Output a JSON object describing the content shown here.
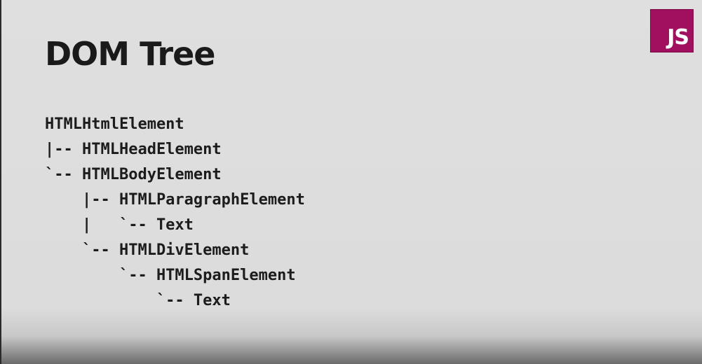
{
  "slide": {
    "title": "DOM Tree",
    "badge": "JS",
    "accent_color": "#a0105f",
    "tree_lines": [
      "HTMLHtmlElement",
      "|-- HTMLHeadElement",
      "`-- HTMLBodyElement",
      "    |-- HTMLParagraphElement",
      "    |   `-- Text",
      "    `-- HTMLDivElement",
      "        `-- HTMLSpanElement",
      "            `-- Text"
    ]
  }
}
